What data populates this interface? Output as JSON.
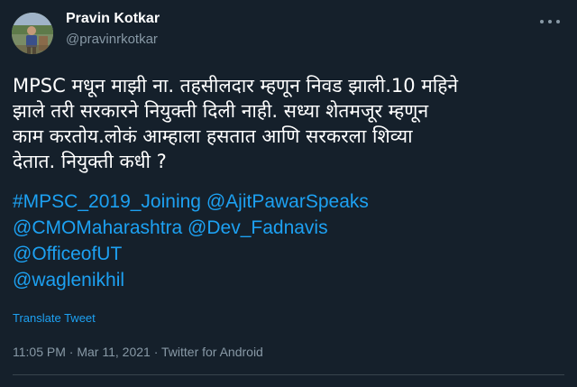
{
  "author": {
    "name": "Pravin Kotkar",
    "handle": "@pravinrkotkar"
  },
  "tweet": {
    "lines": [
      "MPSC मधून माझी ना. तहसीलदार म्हणून निवड झाली.10 महिने",
      "झाले तरी सरकारने नियुक्ती दिली नाही. सध्या शेतमजूर म्हणून",
      "काम करतोय.लोकं आम्हाला हसतात आणि सरकरला शिव्या",
      "देतात. नियुक्ती कधी ?"
    ],
    "tags": [
      [
        "#MPSC_2019_Joining",
        "@AjitPawarSpeaks"
      ],
      [
        "@CMOMaharashtra",
        "@Dev_Fadnavis"
      ],
      [
        "@OfficeofUT"
      ],
      [
        "@waglenikhil"
      ]
    ],
    "translate_label": "Translate Tweet",
    "time": "11:05 PM",
    "date": "Mar 11, 2021",
    "source": "Twitter for Android",
    "separator": "·"
  },
  "colors": {
    "background": "#15202b",
    "accent": "#1da1f2",
    "secondary_text": "#8899a6"
  },
  "icons": {
    "more": "more-horizontal-icon"
  }
}
